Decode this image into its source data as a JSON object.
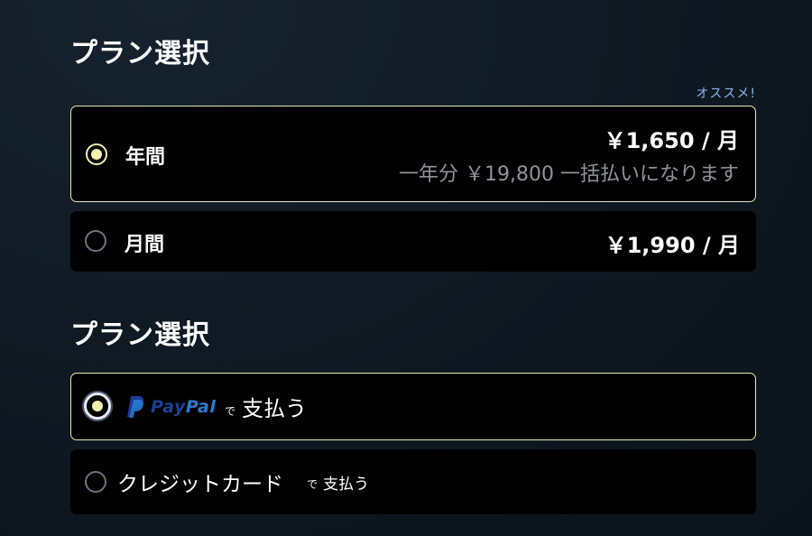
{
  "plan_section": {
    "title": "プラン選択",
    "recommend_badge": "オススメ!",
    "options": [
      {
        "label": "年間",
        "price": "￥1,650 / 月",
        "note": "一年分 ￥19,800 一括払いになります",
        "selected": true
      },
      {
        "label": "月間",
        "price": "￥1,990 / 月",
        "selected": false
      }
    ]
  },
  "payment_section": {
    "title": "プラン選択",
    "options": [
      {
        "logo_text_1": "Pay",
        "logo_text_2": "Pal",
        "connector": "で",
        "action": "支払う",
        "selected": true
      },
      {
        "label": "クレジットカード",
        "connector": "で",
        "action": "支払う",
        "selected": false
      }
    ]
  },
  "colors": {
    "background": "#0f1a24",
    "card": "#000000",
    "selected_border": "#e8ecb0",
    "radio_active": "#f3f0b0",
    "recommend": "#8fb8f2",
    "muted_text": "#8e9299",
    "paypal_dark": "#1c3f94",
    "paypal_light": "#2a7bd0"
  },
  "icons": {
    "paypal_logo": "paypal-p-icon"
  }
}
